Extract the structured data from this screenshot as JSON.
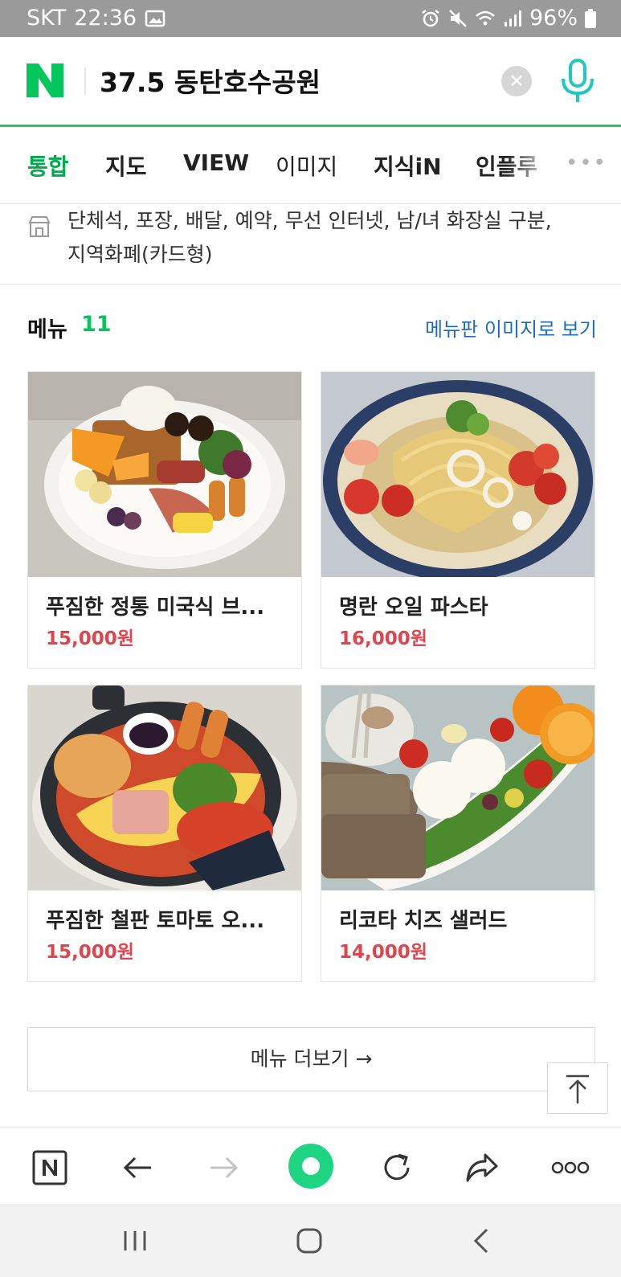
{
  "status_bar": {
    "carrier": "SKT",
    "time": "22:36",
    "battery": "96%",
    "icons": [
      "image-icon",
      "alarm-icon",
      "mute-icon",
      "wifi-icon",
      "signal-icon",
      "battery-icon"
    ]
  },
  "search": {
    "logo": "N",
    "query": "37.5 동탄호수공원",
    "clear_icon": "close-icon",
    "mic_icon": "microphone-icon"
  },
  "tabs": [
    {
      "label": "통합",
      "active": true
    },
    {
      "label": "지도"
    },
    {
      "label": "VIEW"
    },
    {
      "label": "이미지"
    },
    {
      "label": "지식iN"
    },
    {
      "label": "인플루"
    }
  ],
  "tabs_more": "•••",
  "amenities": {
    "icon": "store-icon",
    "text_line1": "단체석, 포장, 배달, 예약, 무선 인터넷, 남/녀 화장실 구분,",
    "text_line2": "지역화폐(카드형)"
  },
  "menu": {
    "title": "메뉴",
    "count": "11",
    "image_link": "메뉴판 이미지로 보기",
    "items": [
      {
        "name": "푸짐한 정통 미국식 브...",
        "price": "15,000원"
      },
      {
        "name": "명란 오일 파스타",
        "price": "16,000원"
      },
      {
        "name": "푸짐한 철판 토마토 오...",
        "price": "15,000원"
      },
      {
        "name": "리코타 치즈 샐러드",
        "price": "14,000원"
      }
    ],
    "more_button": "메뉴 더보기 →"
  },
  "colors": {
    "naver_green": "#03c75a",
    "price_red": "#e1444b",
    "link_blue": "#1d6dbd"
  }
}
